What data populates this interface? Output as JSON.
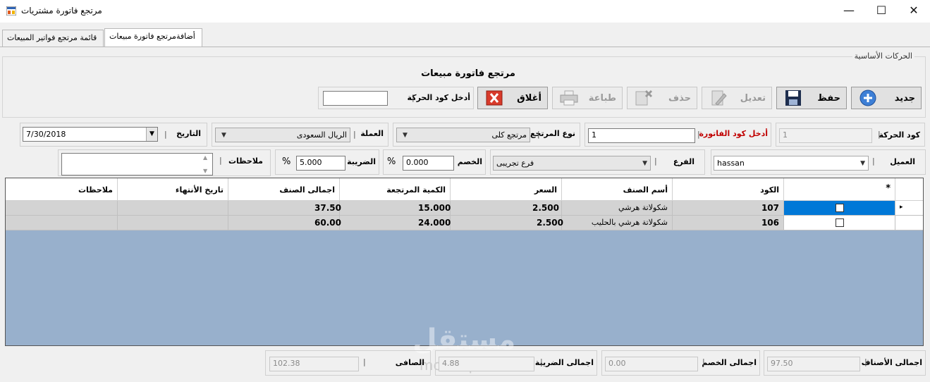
{
  "window": {
    "title": "مرتجع فاتورة مشتريات",
    "controls": {
      "minimize": "—",
      "maximize": "☐",
      "close": "✕"
    }
  },
  "tabs": [
    {
      "label": "قائمة مرتجع فواتير المبيعات",
      "active": false
    },
    {
      "label": "أضافةمرتجع فاتورة مبيعات",
      "active": true
    }
  ],
  "group": {
    "legend": "الحركات الأساسية"
  },
  "form_title": "مرتجع فاتورة مبيعات",
  "toolbar": {
    "new": "جديد",
    "save": "حفظ",
    "edit": "تعديل",
    "delete": "حذف",
    "print": "طباعة",
    "close": "أغلاق",
    "enter_code_label": "أدخل كود الحركة",
    "enter_code_value": ""
  },
  "row1": {
    "movement_code_label": "كود الحركة",
    "movement_code_value": "1",
    "invoice_code_label": "أدخل كود الفاتورة",
    "invoice_code_value": "1",
    "return_type_label": "نوع المرتجع",
    "return_type_value": "مرتجع كلى",
    "currency_label": "العملة",
    "currency_value": "الريال السعودى",
    "date_label": "التاريخ",
    "date_value": "7/30/2018"
  },
  "row2": {
    "customer_label": "العميل",
    "customer_value": "hassan",
    "branch_label": "الفرع",
    "branch_value": "فرع تجريبى",
    "discount_label": "الخصم",
    "discount_value": "0.000",
    "tax_label": "الضريبة",
    "tax_value": "5.000",
    "percent": "%",
    "notes_label": "ملاحظات",
    "notes_value": ""
  },
  "separator": "|",
  "grid": {
    "new_row_marker": "*",
    "current_row_marker": "▸",
    "columns": [
      "الكود",
      "أسم الصنف",
      "السعر",
      "الكمية المرتجعة",
      "اجمالى الصنف",
      "تاريخ الأنتهاء",
      "ملاحظات"
    ],
    "rows": [
      {
        "code": "107",
        "name": "شكولاتة هرشي",
        "price": "2.500",
        "qty": "15.000",
        "total": "37.50",
        "expiry": "",
        "notes": "",
        "checked": false,
        "selected": true
      },
      {
        "code": "106",
        "name": "شكولاتة هرشي بالحليب",
        "price": "2.500",
        "qty": "24.000",
        "total": "60.00",
        "expiry": "",
        "notes": "",
        "checked": false,
        "selected": false
      }
    ]
  },
  "totals": {
    "items_label": "اجمالى الأصناف",
    "items_value": "97.50",
    "discount_label": "اجمالى الخصم",
    "discount_value": "0.00",
    "tax_label": "اجمالى الضريبة",
    "tax_value": "4.88",
    "net_label": "الصافى",
    "net_value": "102.38"
  },
  "watermark": {
    "text": "مستقل",
    "subtext": "mostaql.com"
  },
  "colors": {
    "selected_cell": "#0078d7",
    "grid_bg": "#98b0cc",
    "row_bg": "#d3d3d3",
    "invoice_label": "#c00000"
  }
}
